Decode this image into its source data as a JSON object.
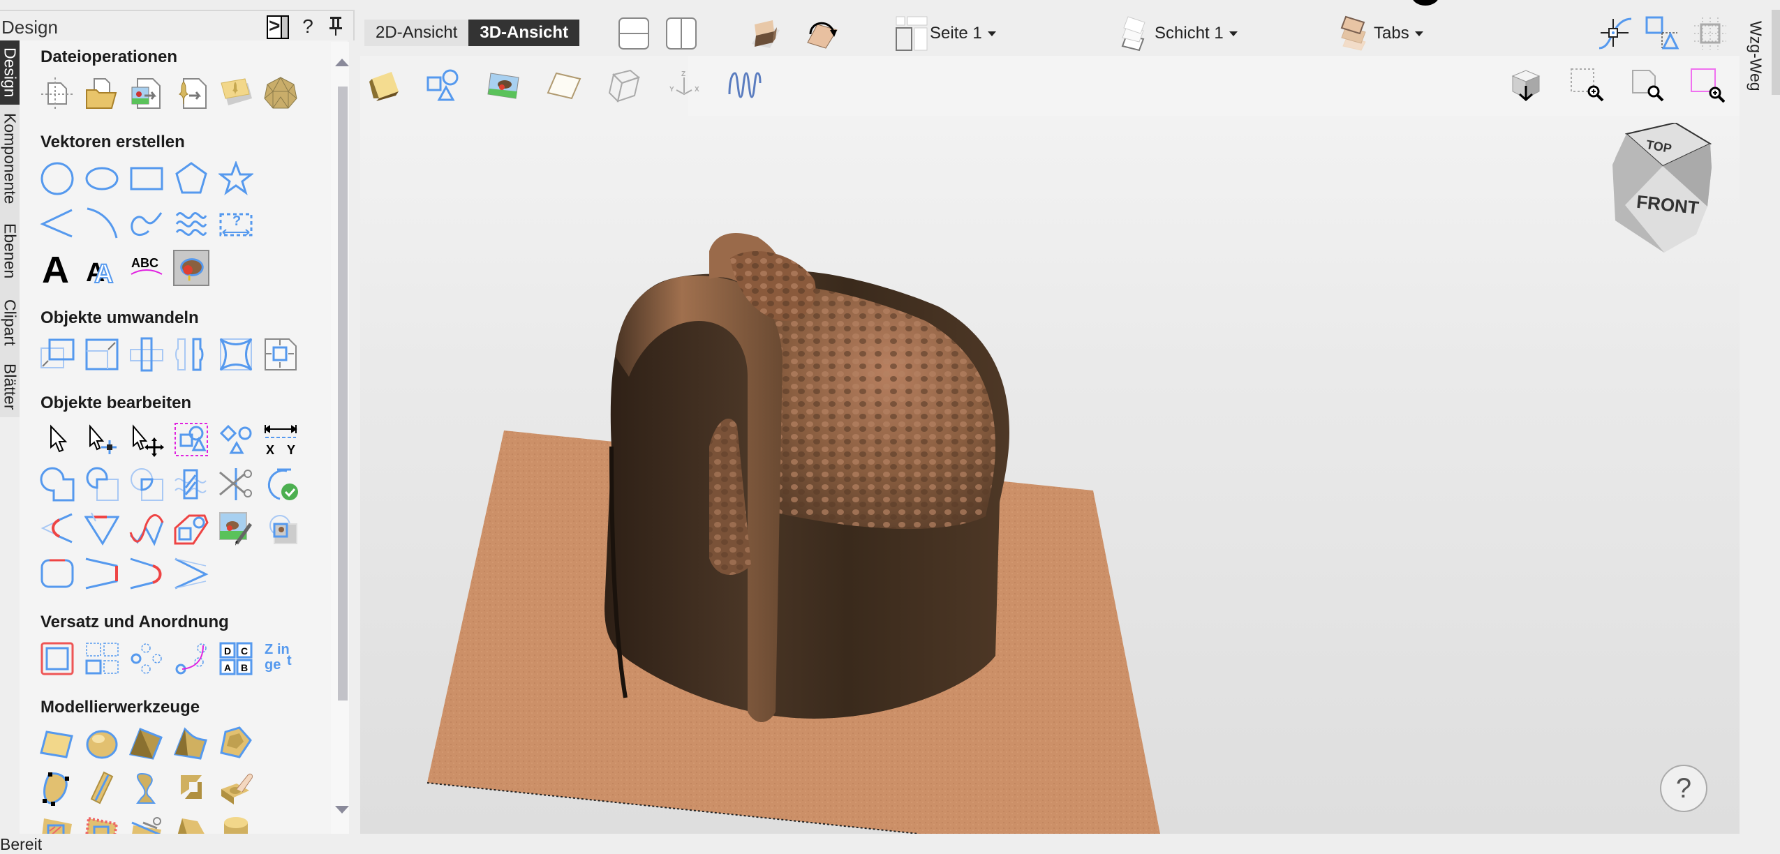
{
  "panel": {
    "title": "Design",
    "header_buttons": {
      "collapse": "collapse-panel",
      "help": "?",
      "pin": "pin"
    },
    "side_tabs": [
      {
        "label": "Design",
        "active": true
      },
      {
        "label": "Komponente",
        "active": false
      },
      {
        "label": "Ebenen",
        "active": false
      },
      {
        "label": "Clipart",
        "active": false
      },
      {
        "label": "Blätter",
        "active": false
      }
    ],
    "sections": [
      {
        "title": "Dateioperationen",
        "tools": [
          "job-setup-icon",
          "open-file-icon",
          "import-bitmap-icon",
          "import-vector-icon",
          "import-component-icon",
          "import-3d-model-icon"
        ]
      },
      {
        "title": "Vektoren erstellen",
        "tools": [
          "circle-icon",
          "ellipse-icon",
          "rectangle-icon",
          "polygon-icon",
          "star-icon",
          "polyline-icon",
          "arc-icon",
          "curve-icon",
          "wave-icon",
          "dimension-icon",
          "text-icon",
          "text-outline-icon",
          "text-on-curve-icon",
          "trace-bitmap-icon"
        ]
      },
      {
        "title": "Objekte umwandeln",
        "tools": [
          "move-icon",
          "scale-icon",
          "rotate-icon",
          "mirror-icon",
          "distort-icon",
          "align-page-icon"
        ]
      },
      {
        "title": "Objekte  bearbeiten",
        "tools": [
          "select-icon",
          "node-edit-icon",
          "transform-icon",
          "group-icon",
          "ungroup-icon",
          "measure-xy-icon",
          "weld-icon",
          "subtract-icon",
          "intersect-icon",
          "fill-icon",
          "trim-icon",
          "close-vector-icon",
          "fillet-icon",
          "chamfer-icon",
          "smooth-icon",
          "boundary-icon",
          "edit-bitmap-icon",
          "mask-bitmap-icon",
          "rounded-corner-icon",
          "extend-icon",
          "curve-fit-icon",
          "join-icon"
        ]
      },
      {
        "title": "Versatz und Anordnung",
        "tools": [
          "offset-icon",
          "array-copy-icon",
          "circular-array-icon",
          "copy-along-curve-icon",
          "nesting-icon",
          "nest-text-icon"
        ]
      },
      {
        "title": "Modellierwerkzeuge",
        "tools": [
          "flat-component-icon",
          "dome-component-icon",
          "pyramid-icon",
          "extrude-icon",
          "two-rail-icon",
          "shape-edit-icon",
          "extrude-rail-icon",
          "turn-icon",
          "weave-icon",
          "sculpt-icon",
          "texture-icon",
          "texture-area-icon",
          "slice-icon",
          "fade-icon",
          "cylinder-icon"
        ]
      }
    ]
  },
  "toolbar": {
    "view_2d": "2D-Ansicht",
    "view_3d": "3D-Ansicht",
    "active_view": "3D-Ansicht",
    "page_dropdown": "Seite 1",
    "layer_dropdown": "Schicht 1",
    "tabs_dropdown": "Tabs"
  },
  "viewport": {
    "view_cube": {
      "top": "TOP",
      "front": "FRONT"
    },
    "help": "?"
  },
  "right_tab": "Wzg-Weg",
  "status": "Bereit",
  "colors": {
    "accent_blue": "#5599ee",
    "active_tab": "#333333",
    "material": "#c98a5e",
    "model": "#4a3424"
  }
}
